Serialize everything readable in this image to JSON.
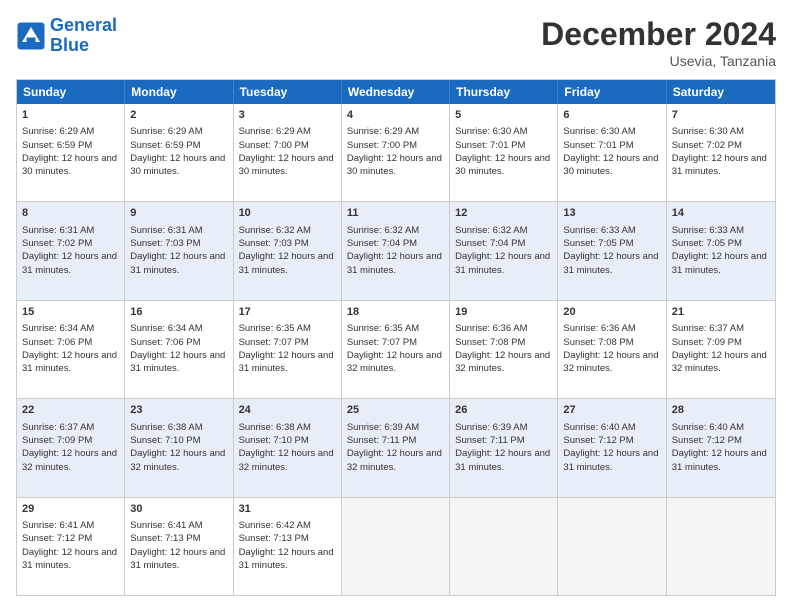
{
  "logo": {
    "line1": "General",
    "line2": "Blue"
  },
  "title": "December 2024",
  "location": "Usevia, Tanzania",
  "days_of_week": [
    "Sunday",
    "Monday",
    "Tuesday",
    "Wednesday",
    "Thursday",
    "Friday",
    "Saturday"
  ],
  "rows": [
    [
      {
        "day": "1",
        "sunrise": "6:29 AM",
        "sunset": "6:59 PM",
        "daylight": "12 hours and 30 minutes."
      },
      {
        "day": "2",
        "sunrise": "6:29 AM",
        "sunset": "6:59 PM",
        "daylight": "12 hours and 30 minutes."
      },
      {
        "day": "3",
        "sunrise": "6:29 AM",
        "sunset": "7:00 PM",
        "daylight": "12 hours and 30 minutes."
      },
      {
        "day": "4",
        "sunrise": "6:29 AM",
        "sunset": "7:00 PM",
        "daylight": "12 hours and 30 minutes."
      },
      {
        "day": "5",
        "sunrise": "6:30 AM",
        "sunset": "7:01 PM",
        "daylight": "12 hours and 30 minutes."
      },
      {
        "day": "6",
        "sunrise": "6:30 AM",
        "sunset": "7:01 PM",
        "daylight": "12 hours and 30 minutes."
      },
      {
        "day": "7",
        "sunrise": "6:30 AM",
        "sunset": "7:02 PM",
        "daylight": "12 hours and 31 minutes."
      }
    ],
    [
      {
        "day": "8",
        "sunrise": "6:31 AM",
        "sunset": "7:02 PM",
        "daylight": "12 hours and 31 minutes."
      },
      {
        "day": "9",
        "sunrise": "6:31 AM",
        "sunset": "7:03 PM",
        "daylight": "12 hours and 31 minutes."
      },
      {
        "day": "10",
        "sunrise": "6:32 AM",
        "sunset": "7:03 PM",
        "daylight": "12 hours and 31 minutes."
      },
      {
        "day": "11",
        "sunrise": "6:32 AM",
        "sunset": "7:04 PM",
        "daylight": "12 hours and 31 minutes."
      },
      {
        "day": "12",
        "sunrise": "6:32 AM",
        "sunset": "7:04 PM",
        "daylight": "12 hours and 31 minutes."
      },
      {
        "day": "13",
        "sunrise": "6:33 AM",
        "sunset": "7:05 PM",
        "daylight": "12 hours and 31 minutes."
      },
      {
        "day": "14",
        "sunrise": "6:33 AM",
        "sunset": "7:05 PM",
        "daylight": "12 hours and 31 minutes."
      }
    ],
    [
      {
        "day": "15",
        "sunrise": "6:34 AM",
        "sunset": "7:06 PM",
        "daylight": "12 hours and 31 minutes."
      },
      {
        "day": "16",
        "sunrise": "6:34 AM",
        "sunset": "7:06 PM",
        "daylight": "12 hours and 31 minutes."
      },
      {
        "day": "17",
        "sunrise": "6:35 AM",
        "sunset": "7:07 PM",
        "daylight": "12 hours and 31 minutes."
      },
      {
        "day": "18",
        "sunrise": "6:35 AM",
        "sunset": "7:07 PM",
        "daylight": "12 hours and 32 minutes."
      },
      {
        "day": "19",
        "sunrise": "6:36 AM",
        "sunset": "7:08 PM",
        "daylight": "12 hours and 32 minutes."
      },
      {
        "day": "20",
        "sunrise": "6:36 AM",
        "sunset": "7:08 PM",
        "daylight": "12 hours and 32 minutes."
      },
      {
        "day": "21",
        "sunrise": "6:37 AM",
        "sunset": "7:09 PM",
        "daylight": "12 hours and 32 minutes."
      }
    ],
    [
      {
        "day": "22",
        "sunrise": "6:37 AM",
        "sunset": "7:09 PM",
        "daylight": "12 hours and 32 minutes."
      },
      {
        "day": "23",
        "sunrise": "6:38 AM",
        "sunset": "7:10 PM",
        "daylight": "12 hours and 32 minutes."
      },
      {
        "day": "24",
        "sunrise": "6:38 AM",
        "sunset": "7:10 PM",
        "daylight": "12 hours and 32 minutes."
      },
      {
        "day": "25",
        "sunrise": "6:39 AM",
        "sunset": "7:11 PM",
        "daylight": "12 hours and 32 minutes."
      },
      {
        "day": "26",
        "sunrise": "6:39 AM",
        "sunset": "7:11 PM",
        "daylight": "12 hours and 31 minutes."
      },
      {
        "day": "27",
        "sunrise": "6:40 AM",
        "sunset": "7:12 PM",
        "daylight": "12 hours and 31 minutes."
      },
      {
        "day": "28",
        "sunrise": "6:40 AM",
        "sunset": "7:12 PM",
        "daylight": "12 hours and 31 minutes."
      }
    ],
    [
      {
        "day": "29",
        "sunrise": "6:41 AM",
        "sunset": "7:12 PM",
        "daylight": "12 hours and 31 minutes."
      },
      {
        "day": "30",
        "sunrise": "6:41 AM",
        "sunset": "7:13 PM",
        "daylight": "12 hours and 31 minutes."
      },
      {
        "day": "31",
        "sunrise": "6:42 AM",
        "sunset": "7:13 PM",
        "daylight": "12 hours and 31 minutes."
      },
      null,
      null,
      null,
      null
    ]
  ]
}
